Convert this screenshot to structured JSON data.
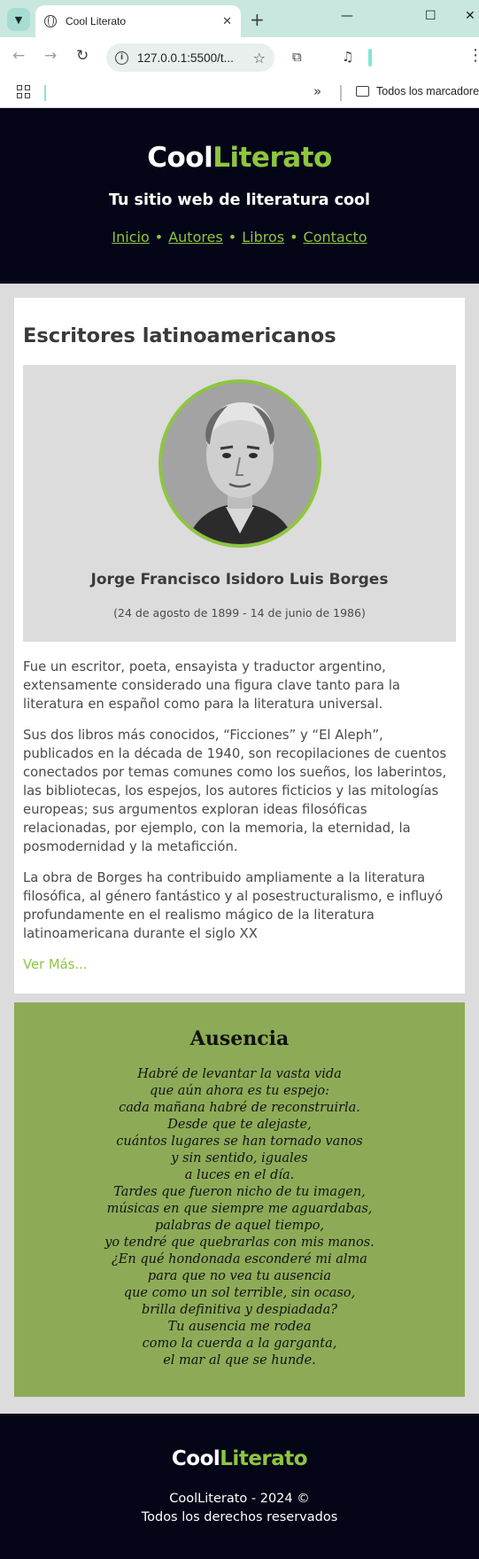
{
  "browser": {
    "tab_title": "Cool Literato",
    "new_tab": "+",
    "url": "127.0.0.1:5500/t...",
    "bookmarks_label": "Todos los marcadores",
    "bookmarks_more": "»"
  },
  "site": {
    "logo_part1": "Cool",
    "logo_part2": "Literato",
    "tagline": "Tu sitio web de literatura cool",
    "nav": [
      {
        "label": "Inicio"
      },
      {
        "label": "Autores"
      },
      {
        "label": "Libros"
      },
      {
        "label": "Contacto"
      }
    ],
    "nav_separator": "•"
  },
  "section": {
    "heading": "Escritores latinoamericanos",
    "author_name": "Jorge Francisco Isidoro Luis Borges",
    "author_dates": "(24 de agosto de 1899 - 14 de junio de 1986)",
    "paragraphs": [
      "Fue un escritor, poeta, ensayista y traductor argentino, extensamente considerado una figura clave tanto para la literatura en español como para la literatura universal.",
      "Sus dos libros más conocidos, “Ficciones” y “El Aleph”, publicados en la década de 1940, son recopilaciones de cuentos conectados por temas comunes como los sueños, los laberintos, las bibliotecas, los espejos, los autores ficticios y las mitologías europeas; sus argumentos exploran ideas filosóficas relacionadas, por ejemplo, con la memoria, la eternidad, la posmodernidad y la metaficción.",
      "La obra de Borges ha contribuido ampliamente a la literatura filosófica, al género fantástico y al posestructuralismo, e influyó profundamente en el realismo mágico de la literatura latinoamericana durante el siglo XX"
    ],
    "more_link": "Ver Más..."
  },
  "poem": {
    "title": "Ausencia",
    "lines": [
      "Habré de levantar la vasta vida",
      "que aún ahora es tu espejo:",
      "cada mañana habré de reconstruirla.",
      "Desde que te alejaste,",
      "cuántos lugares se han tornado vanos",
      "y sin sentido, iguales",
      "a luces en el día.",
      "Tardes que fueron nicho de tu imagen,",
      "músicas en que siempre me aguardabas,",
      "palabras de aquel tiempo,",
      "yo tendré que quebrarlas con mis manos.",
      "¿En qué hondonada esconderé mi alma",
      "para que no vea tu ausencia",
      "que como un sol terrible, sin ocaso,",
      "brilla definitiva y despiadada?",
      "Tu ausencia me rodea",
      "como la cuerda a la garganta,",
      "el mar al que se hunde."
    ]
  },
  "footer": {
    "copyright": "CoolLiterato - 2024 ©",
    "rights": "Todos los derechos reservados"
  },
  "colors": {
    "accent": "#8dc63f",
    "header_bg": "#050518",
    "poem_bg": "#8dab57",
    "page_bg": "#dcdcdc"
  }
}
